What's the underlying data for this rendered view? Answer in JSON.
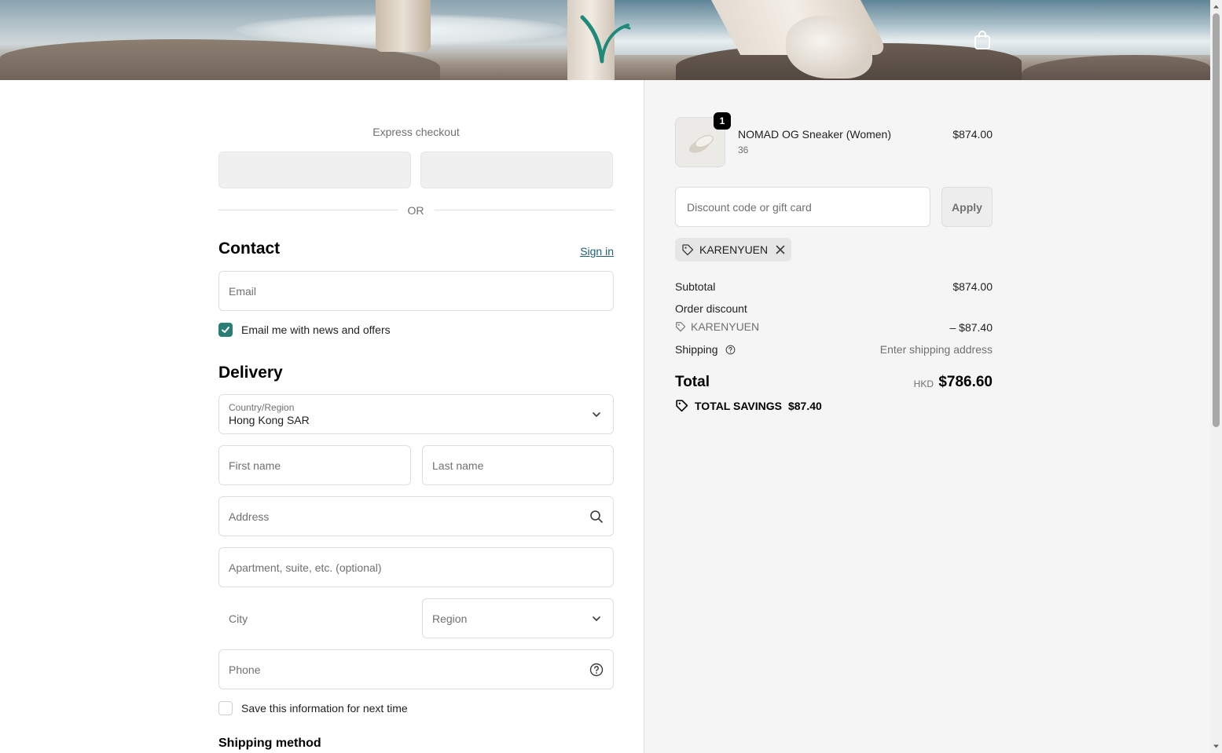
{
  "header": {
    "logo_icon": "brand-leaf-logo-icon",
    "cart_icon": "shopping-bag-icon",
    "accent": "#1f8a7a"
  },
  "checkout": {
    "express_label": "Express checkout",
    "or_label": "OR",
    "contact": {
      "title": "Contact",
      "sign_in": "Sign in",
      "email_placeholder": "Email",
      "news_label": "Email me with news and offers",
      "news_checked": true
    },
    "delivery": {
      "title": "Delivery",
      "country_label": "Country/Region",
      "country_value": "Hong Kong SAR",
      "first_name_placeholder": "First name",
      "last_name_placeholder": "Last name",
      "address_placeholder": "Address",
      "apartment_placeholder": "Apartment, suite, etc. (optional)",
      "city_placeholder": "City",
      "region_placeholder": "Region",
      "phone_placeholder": "Phone",
      "save_label": "Save this information for next time",
      "save_checked": false
    },
    "shipping_method_title": "Shipping method"
  },
  "summary": {
    "item": {
      "quantity": "1",
      "name": "NOMAD OG Sneaker (Women)",
      "variant": "36",
      "price": "$874.00"
    },
    "discount_placeholder": "Discount code or gift card",
    "apply_label": "Apply",
    "applied_code": "KARENYUEN",
    "subtotal_label": "Subtotal",
    "subtotal_value": "$874.00",
    "order_discount_label": "Order discount",
    "discount_code": "KARENYUEN",
    "discount_value": "– $87.40",
    "shipping_label": "Shipping",
    "shipping_value": "Enter shipping address",
    "total_label": "Total",
    "total_currency": "HKD",
    "total_value": "$786.60",
    "savings_label": "TOTAL SAVINGS",
    "savings_value": "$87.40"
  },
  "colors": {
    "checkbox_checked": "#2a7d75",
    "link": "#1e5f74",
    "summary_bg": "#f5f5f5"
  }
}
